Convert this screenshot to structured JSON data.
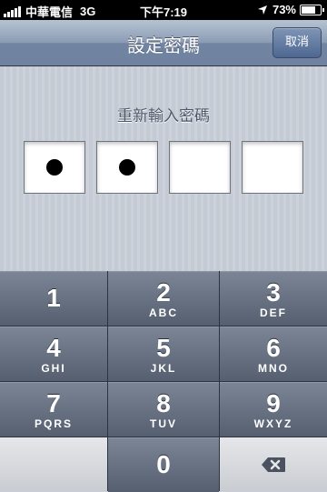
{
  "status_bar": {
    "carrier": "中華電信",
    "network": "3G",
    "time": "下午7:19",
    "battery": "73%",
    "battery_level": 0.73
  },
  "nav_bar": {
    "title": "設定密碼",
    "cancel_label": "取消"
  },
  "passcode": {
    "prompt": "重新輸入密碼",
    "entered_digits": 2,
    "total_digits": 4
  },
  "keypad": {
    "keys": [
      {
        "num": "1",
        "letters": ""
      },
      {
        "num": "2",
        "letters": "ABC"
      },
      {
        "num": "3",
        "letters": "DEF"
      },
      {
        "num": "4",
        "letters": "GHI"
      },
      {
        "num": "5",
        "letters": "JKL"
      },
      {
        "num": "6",
        "letters": "MNO"
      },
      {
        "num": "7",
        "letters": "PQRS"
      },
      {
        "num": "8",
        "letters": "TUV"
      },
      {
        "num": "9",
        "letters": "WXYZ"
      },
      {
        "num": "0",
        "letters": ""
      }
    ],
    "delete_icon": "backspace-icon"
  }
}
